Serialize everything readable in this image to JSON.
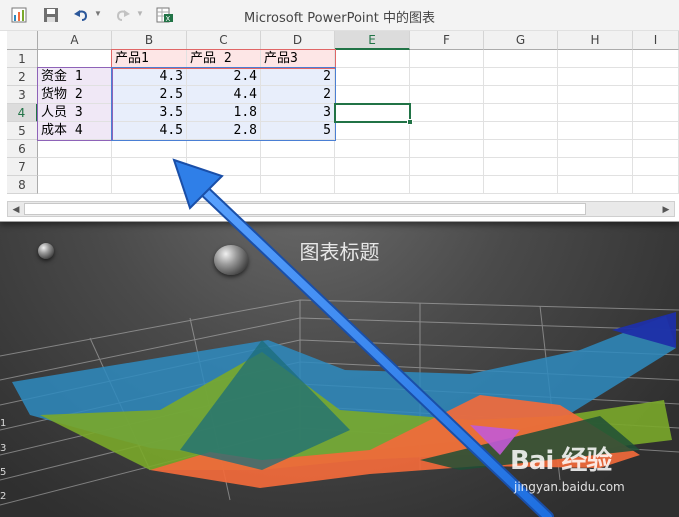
{
  "window": {
    "title": "Microsoft PowerPoint 中的图表"
  },
  "toolbar": {
    "icons": [
      "chart-icon",
      "save-icon",
      "undo-icon",
      "redo-icon",
      "excel-edit-icon"
    ]
  },
  "sheet": {
    "columns": [
      "A",
      "B",
      "C",
      "D",
      "E",
      "F",
      "G",
      "H",
      "I"
    ],
    "rows": [
      "1",
      "2",
      "3",
      "4",
      "5",
      "6",
      "7",
      "8"
    ],
    "selected_column": "E",
    "selected_row": "4",
    "header_row": [
      "产品1",
      "产品 2",
      "产品3"
    ],
    "data_rows": [
      {
        "label": "资金 1",
        "values": [
          "4.3",
          "2.4",
          "2"
        ]
      },
      {
        "label": "货物 2",
        "values": [
          "2.5",
          "4.4",
          "2"
        ]
      },
      {
        "label": "人员 3",
        "values": [
          "3.5",
          "1.8",
          "3"
        ]
      },
      {
        "label": "成本 4",
        "values": [
          "4.5",
          "2.8",
          "5"
        ]
      }
    ]
  },
  "chart": {
    "title": "图表标题",
    "axis_ticks": [
      "1",
      "3",
      "5",
      "2"
    ]
  },
  "watermark": {
    "brand": "Bai 经验",
    "url": "jingyan.baidu.com"
  },
  "colors": {
    "excel_green": "#217346",
    "arrow_blue": "#2f7fe8",
    "series_1": "#2e8bc0",
    "series_2": "#7aa92a",
    "series_3": "#f26a3b"
  }
}
